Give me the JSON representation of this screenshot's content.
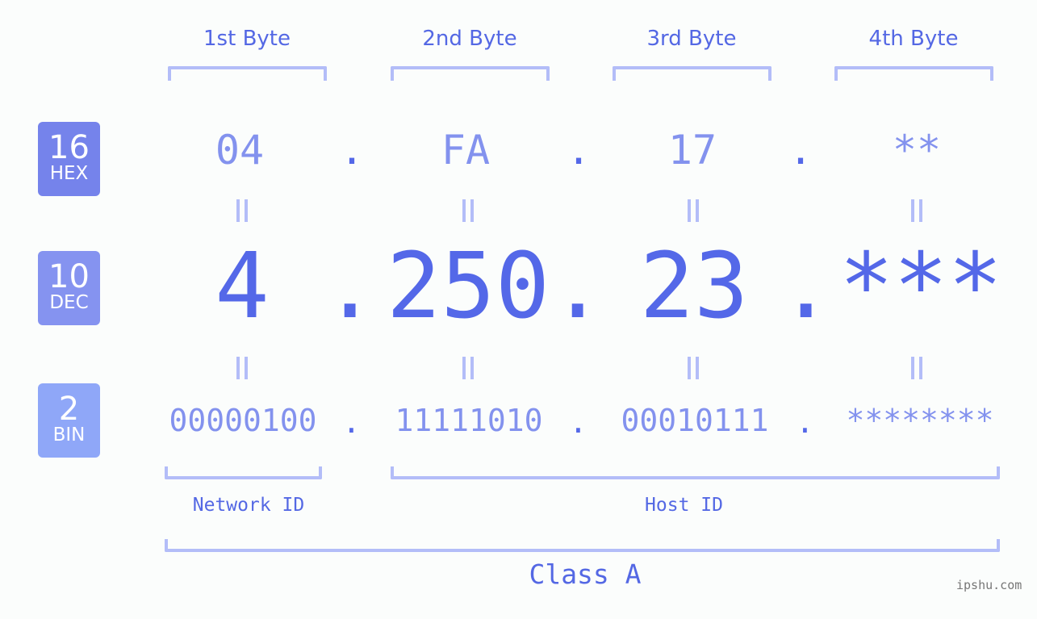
{
  "headers": [
    "1st Byte",
    "2nd Byte",
    "3rd Byte",
    "4th Byte"
  ],
  "badges": {
    "hex": {
      "num": "16",
      "label": "HEX",
      "color": "#7583eb"
    },
    "dec": {
      "num": "10",
      "label": "DEC",
      "color": "#8593f0"
    },
    "bin": {
      "num": "2",
      "label": "BIN",
      "color": "#8fa7f8"
    }
  },
  "hex": [
    "04",
    "FA",
    "17",
    "**"
  ],
  "dec": [
    "4",
    "250",
    "23",
    "***"
  ],
  "bin": [
    "00000100",
    "11111010",
    "00010111",
    "********"
  ],
  "separator": ".",
  "network_id_label": "Network ID",
  "host_id_label": "Host ID",
  "class_label": "Class A",
  "watermark": "ipshu.com",
  "colors": {
    "accent": "#5468e8",
    "light": "#8392ee",
    "bracket": "#b3bdf8"
  }
}
